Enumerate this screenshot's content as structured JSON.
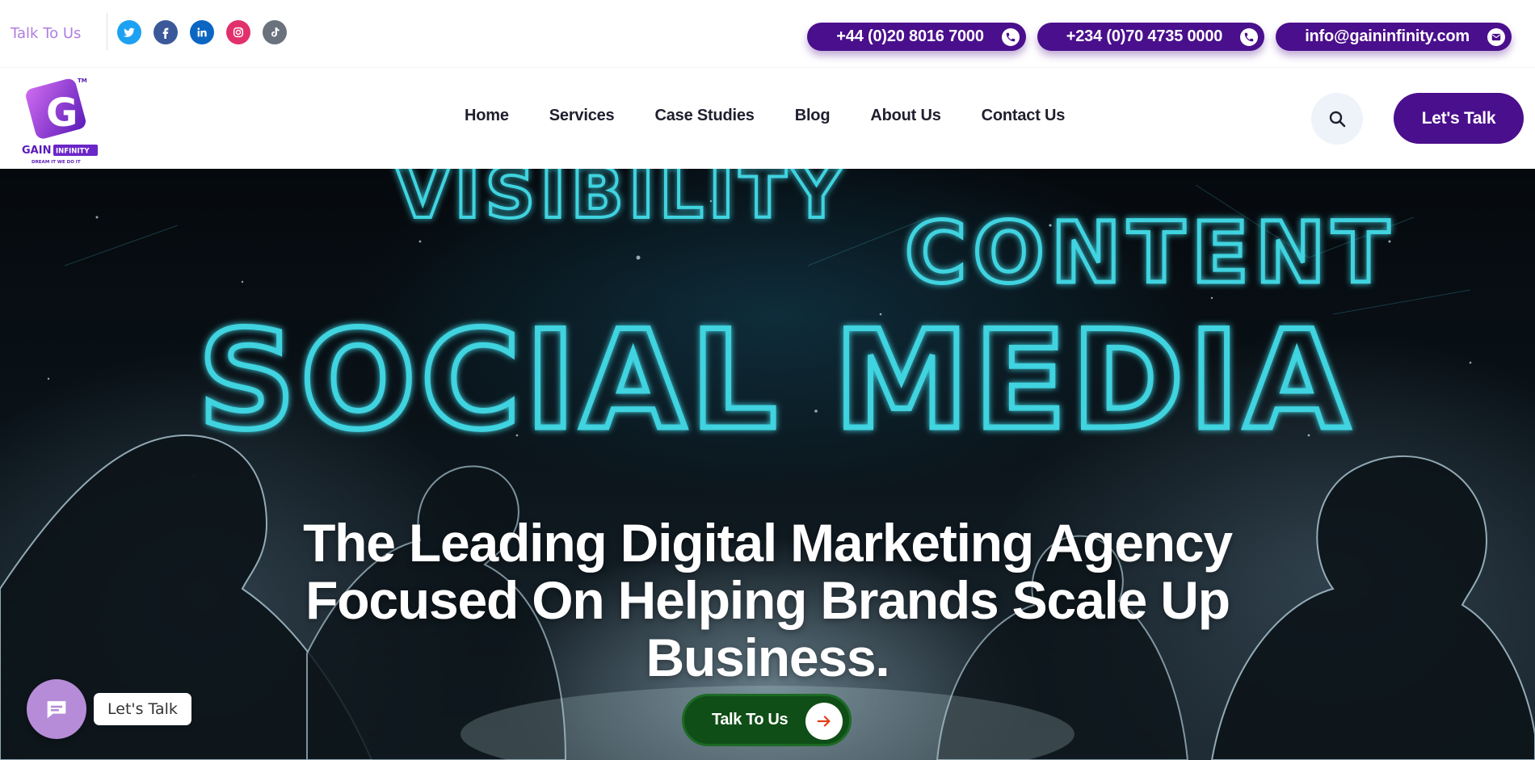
{
  "topbar": {
    "talk_link": "Talk To Us",
    "socials": [
      {
        "icon": "twitter-icon",
        "color": "#1da1f2"
      },
      {
        "icon": "facebook-icon",
        "color": "#3b5998"
      },
      {
        "icon": "linkedin-icon",
        "color": "#0a66c2"
      },
      {
        "icon": "instagram-icon",
        "color": "#e1306c"
      },
      {
        "icon": "tiktok-icon",
        "color": "#69727d"
      }
    ],
    "contacts": [
      {
        "text": "+44 (0)20 8016 7000",
        "icon": "phone-icon"
      },
      {
        "text": "+234 (0)70 4735 0000",
        "icon": "phone-icon"
      },
      {
        "text": "info@gaininfinity.com",
        "icon": "envelope-icon"
      }
    ]
  },
  "logo": {
    "brand_left": "GAIN",
    "brand_right": "INFINITY",
    "tagline": "DREAM IT WE DO IT",
    "tm": "TM",
    "letter": "G"
  },
  "nav": {
    "items": [
      "Home",
      "Services",
      "Case Studies",
      "Blog",
      "About Us",
      "Contact Us"
    ],
    "active": "Home",
    "cta": "Let's Talk"
  },
  "hero": {
    "background_words": [
      "VISIBILITY",
      "CONTENT",
      "SOCIAL MEDIA"
    ],
    "headline": "The Leading Digital Marketing Agency Focused On Helping Brands Scale Up Business.",
    "cta": "Talk To Us"
  },
  "chat": {
    "label": "Let's Talk"
  },
  "colors": {
    "primary": "#4a0f8c",
    "accent": "#a55fe6",
    "cta_green": "#0f4e16",
    "hero_text_glow": "#3fd3e0"
  }
}
